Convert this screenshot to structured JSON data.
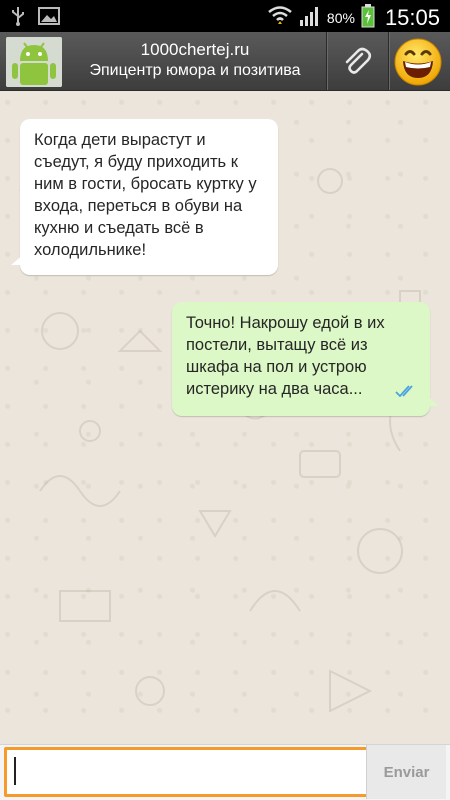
{
  "status_bar": {
    "battery_percent": "80%",
    "time": "15:05"
  },
  "header": {
    "contact_name": "1000chertej.ru",
    "contact_status": "Эпицентр юмора и позитива",
    "avatar_icon": "android-robot-icon",
    "attach_icon": "paperclip-icon",
    "emoji_icon": "smiley-face-icon"
  },
  "messages": [
    {
      "direction": "incoming",
      "text": "Когда дети вырастут и\nсъедут, я буду приходить к\nним в гости, бросать куртку у\nвхода, переться в обуви на\nкухню и съедать всё в\nхолодильнике!"
    },
    {
      "direction": "outgoing",
      "text": "Точно! Накрошу едой в их\nпостели, вытащу всё из\nшкафа на пол и устрою\nистерику на два часа...",
      "status_icon": "double-check-icon"
    }
  ],
  "composer": {
    "input_value": "",
    "send_label": "Enviar"
  },
  "colors": {
    "incoming_bubble": "#ffffff",
    "outgoing_bubble": "#dcf8c6",
    "input_border": "#f59b2b",
    "read_ticks": "#4aa3df"
  }
}
